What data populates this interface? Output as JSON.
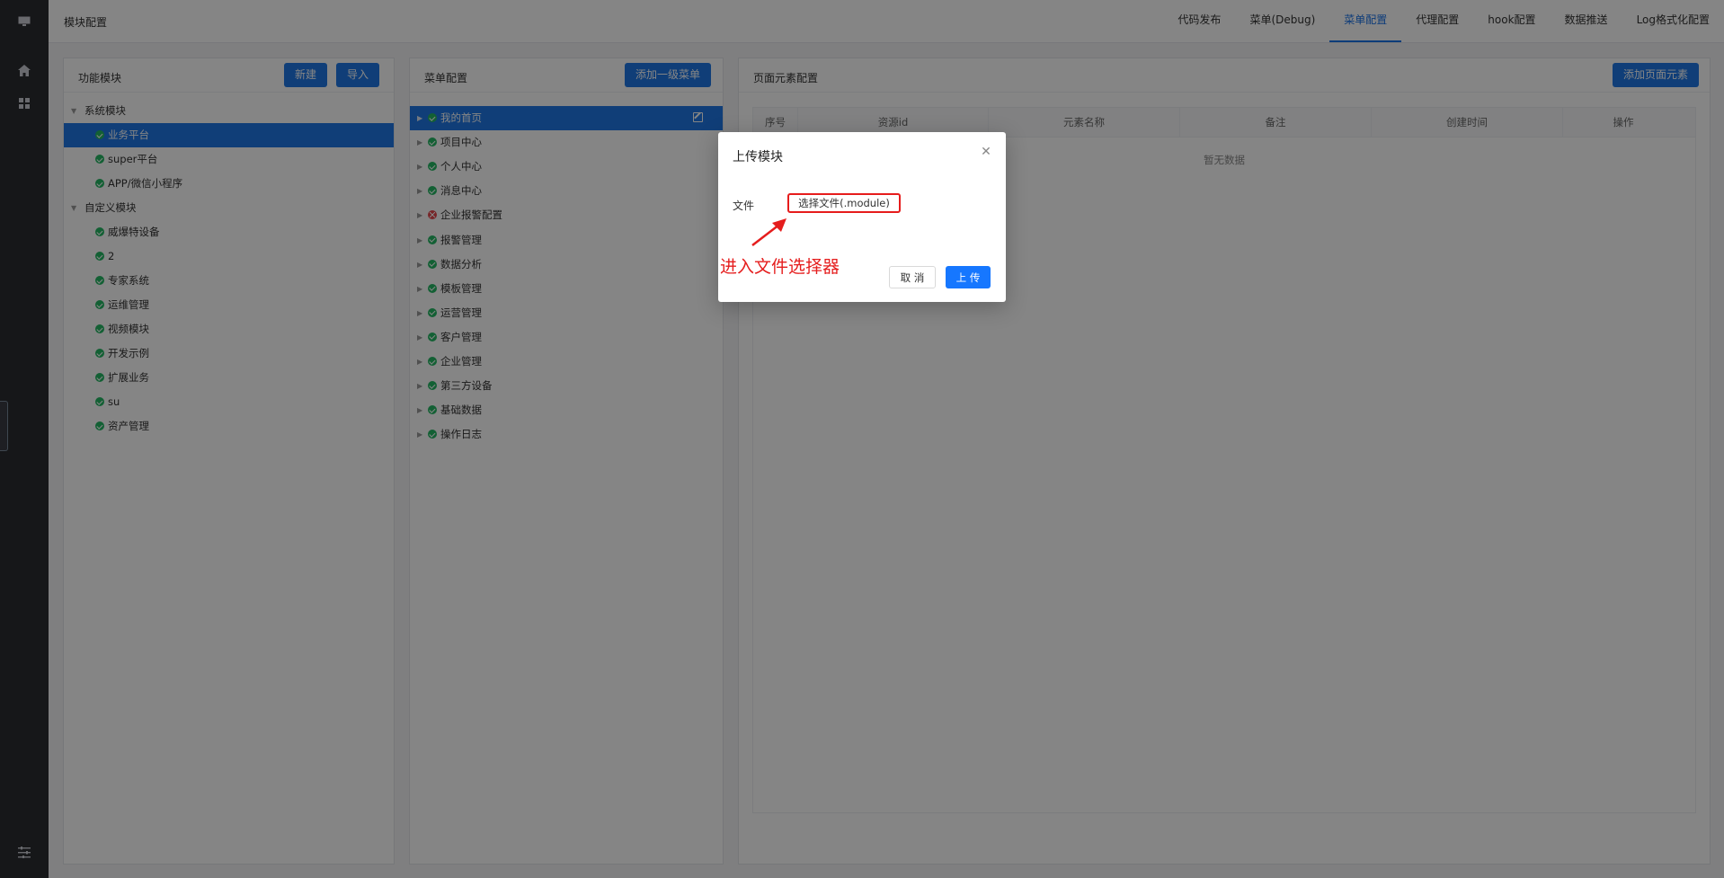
{
  "header": {
    "title": "模块配置",
    "tabs": [
      {
        "label": "代码发布",
        "active": false
      },
      {
        "label": "菜单(Debug)",
        "active": false
      },
      {
        "label": "菜单配置",
        "active": true
      },
      {
        "label": "代理配置",
        "active": false
      },
      {
        "label": "hook配置",
        "active": false
      },
      {
        "label": "数据推送",
        "active": false
      },
      {
        "label": "Log格式化配置",
        "active": false
      }
    ]
  },
  "rail": {
    "icons": [
      "monitor-icon",
      "home-icon",
      "grid-icon",
      "sliders-icon"
    ]
  },
  "modules_panel": {
    "title": "功能模块",
    "new_label": "新建",
    "import_label": "导入",
    "groups": [
      {
        "label": "系统模块",
        "items": [
          "业务平台",
          "super平台",
          "APP/微信小程序"
        ]
      },
      {
        "label": "自定义模块",
        "items": [
          "威爆特设备",
          "2",
          "专家系统",
          "运维管理",
          "视频模块",
          "开发示例",
          "扩展业务",
          "su",
          "资产管理"
        ]
      }
    ],
    "selected": "业务平台"
  },
  "menu_panel": {
    "title": "菜单配置",
    "add_label": "添加一级菜单",
    "items": [
      {
        "label": "我的首页",
        "status": "ok"
      },
      {
        "label": "项目中心",
        "status": "ok"
      },
      {
        "label": "个人中心",
        "status": "ok"
      },
      {
        "label": "消息中心",
        "status": "ok"
      },
      {
        "label": "企业报警配置",
        "status": "error"
      },
      {
        "label": "报警管理",
        "status": "ok"
      },
      {
        "label": "数据分析",
        "status": "ok"
      },
      {
        "label": "模板管理",
        "status": "ok"
      },
      {
        "label": "运营管理",
        "status": "ok"
      },
      {
        "label": "客户管理",
        "status": "ok"
      },
      {
        "label": "企业管理",
        "status": "ok"
      },
      {
        "label": "第三方设备",
        "status": "ok"
      },
      {
        "label": "基础数据",
        "status": "ok"
      },
      {
        "label": "操作日志",
        "status": "ok"
      }
    ],
    "selected": "我的首页"
  },
  "elements_panel": {
    "title": "页面元素配置",
    "add_label": "添加页面元素",
    "columns": [
      "序号",
      "资源id",
      "元素名称",
      "备注",
      "创建时间",
      "操作"
    ],
    "empty_text": "暂无数据"
  },
  "modal": {
    "title": "上传模块",
    "file_label": "文件",
    "file_button": "选择文件(.module)",
    "cancel_label": "取 消",
    "upload_label": "上 传"
  },
  "annotation": {
    "text": "进入文件选择器",
    "color": "#e51d1d"
  },
  "colors": {
    "accent": "#1f78e6",
    "ok": "#25b864",
    "error": "#e5484d"
  }
}
